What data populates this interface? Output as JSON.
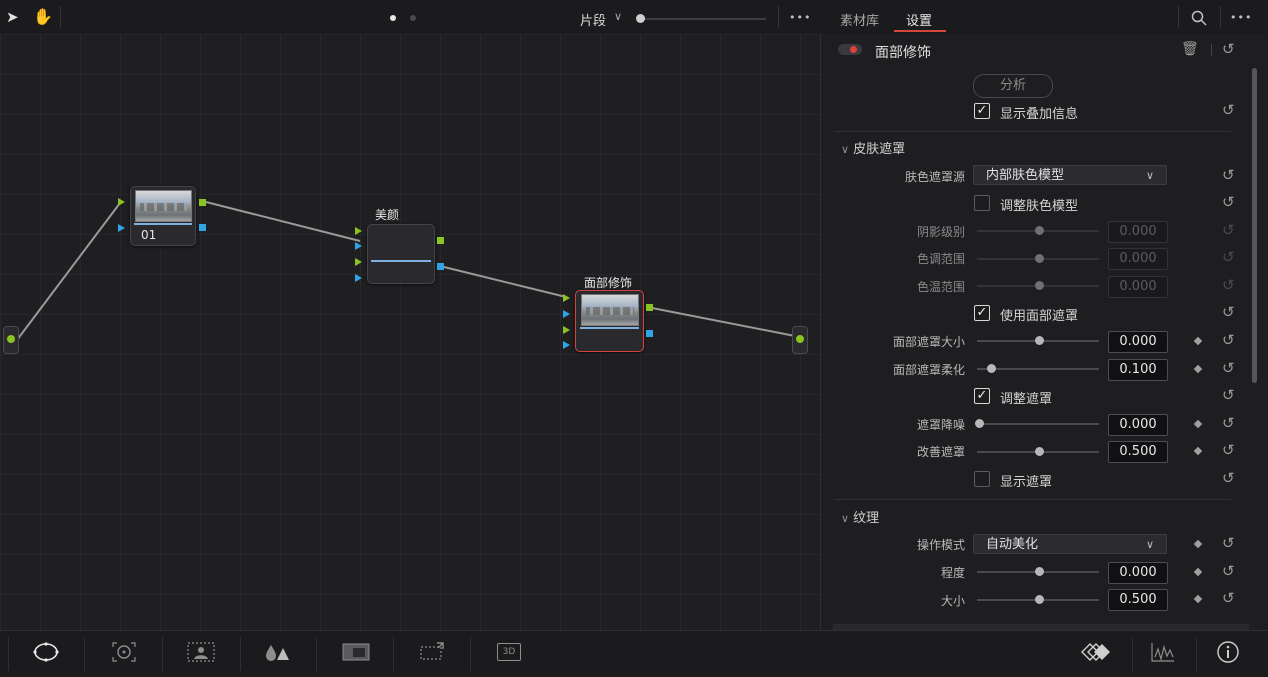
{
  "toolbar": {
    "pointer_icon": "pointer-icon",
    "hand_icon": "hand-icon",
    "clip_label": "片段",
    "more": "•••"
  },
  "panel_tabs": {
    "media": "素材库",
    "settings": "设置",
    "more": "•••"
  },
  "nodes": {
    "node1_label": "01",
    "node2_title": "美颜",
    "node3_title": "面部修饰"
  },
  "fx": {
    "title": "面部修饰",
    "analyze": "分析",
    "show_overlay": "显示叠加信息"
  },
  "skin_mask": {
    "heading": "皮肤遮罩",
    "source_label": "肤色遮罩源",
    "source_value": "内部肤色模型",
    "adjust_model": "调整肤色模型",
    "shadow_label": "阴影级别",
    "shadow_value": "0.000",
    "tone_label": "色调范围",
    "tone_value": "0.000",
    "temp_label": "色温范围",
    "temp_value": "0.000",
    "use_face_mask": "使用面部遮罩",
    "face_size_label": "面部遮罩大小",
    "face_size_value": "0.000",
    "face_soft_label": "面部遮罩柔化",
    "face_soft_value": "0.100",
    "adjust_mask": "调整遮罩",
    "denoise_label": "遮罩降噪",
    "denoise_value": "0.000",
    "refine_label": "改善遮罩",
    "refine_value": "0.500",
    "show_mask": "显示遮罩"
  },
  "texture": {
    "heading": "纹理",
    "mode_label": "操作模式",
    "mode_value": "自动美化",
    "degree_label": "程度",
    "degree_value": "0.000",
    "size_label": "大小",
    "size_value": "0.500"
  },
  "colors": {
    "accent_red": "#d6453d",
    "port_green": "#8ac420",
    "port_blue": "#2fa4e7"
  }
}
